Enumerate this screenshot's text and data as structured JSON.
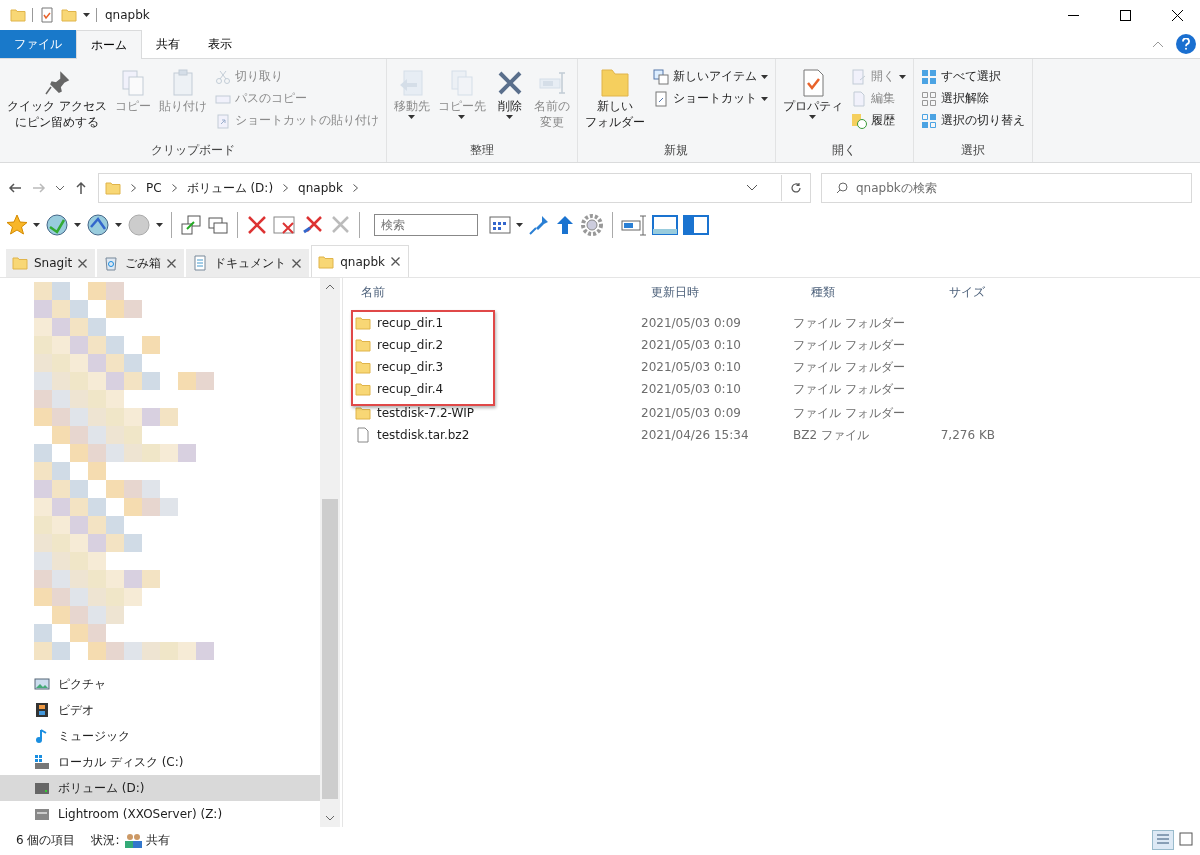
{
  "window": {
    "title": "qnapbk"
  },
  "ribbon_tabs": [
    {
      "label": "ファイル",
      "kind": "file",
      "selected": false
    },
    {
      "label": "ホーム",
      "kind": "tab",
      "selected": true
    },
    {
      "label": "共有",
      "kind": "tab",
      "selected": false
    },
    {
      "label": "表示",
      "kind": "tab",
      "selected": false
    }
  ],
  "ribbon_groups": [
    {
      "label": "クリップボード",
      "items": [
        {
          "kind": "large",
          "label_lines": [
            "クイック アクセス",
            "にピン留めする"
          ],
          "disabled": false,
          "has_menu": false
        },
        {
          "kind": "large",
          "label_lines": [
            "コピー"
          ],
          "disabled": true,
          "has_menu": false
        },
        {
          "kind": "large",
          "label_lines": [
            "貼り付け"
          ],
          "disabled": true,
          "has_menu": false
        },
        {
          "kind": "stack",
          "items": [
            {
              "label": "切り取り",
              "disabled": true,
              "has_menu": false
            },
            {
              "label": "パスのコピー",
              "disabled": true,
              "has_menu": false
            },
            {
              "label": "ショートカットの貼り付け",
              "disabled": true,
              "has_menu": false
            }
          ]
        }
      ]
    },
    {
      "label": "整理",
      "items": [
        {
          "kind": "large",
          "label_lines": [
            "移動先"
          ],
          "disabled": true,
          "has_menu": true
        },
        {
          "kind": "large",
          "label_lines": [
            "コピー先"
          ],
          "disabled": true,
          "has_menu": true
        },
        {
          "kind": "large",
          "label_lines": [
            "削除"
          ],
          "disabled": false,
          "has_menu": true
        },
        {
          "kind": "large",
          "label_lines": [
            "名前の",
            "変更"
          ],
          "disabled": true,
          "has_menu": false
        }
      ]
    },
    {
      "label": "新規",
      "items": [
        {
          "kind": "large",
          "label_lines": [
            "新しい",
            "フォルダー"
          ],
          "disabled": false,
          "has_menu": false
        },
        {
          "kind": "stack",
          "items": [
            {
              "label": "新しいアイテム",
              "disabled": false,
              "has_menu": true
            },
            {
              "label": "ショートカット",
              "disabled": false,
              "has_menu": true
            }
          ]
        }
      ]
    },
    {
      "label": "開く",
      "items": [
        {
          "kind": "large",
          "label_lines": [
            "プロパティ"
          ],
          "disabled": false,
          "has_menu": true
        },
        {
          "kind": "stack",
          "items": [
            {
              "label": "開く",
              "disabled": true,
              "has_menu": true
            },
            {
              "label": "編集",
              "disabled": true,
              "has_menu": false
            },
            {
              "label": "履歴",
              "disabled": false,
              "has_menu": false
            }
          ]
        }
      ]
    },
    {
      "label": "選択",
      "items": [
        {
          "kind": "stack",
          "items": [
            {
              "label": "すべて選択",
              "disabled": false,
              "has_menu": false
            },
            {
              "label": "選択解除",
              "disabled": false,
              "has_menu": false
            },
            {
              "label": "選択の切り替え",
              "disabled": false,
              "has_menu": false
            }
          ]
        }
      ]
    }
  ],
  "address": {
    "segments": [
      "PC",
      "ボリューム (D:)",
      "qnapbk"
    ],
    "search_placeholder": "qnapbkの検索"
  },
  "toolbar": {
    "search_placeholder": "検索"
  },
  "tabs": [
    {
      "label": "Snagit",
      "kind": "folder",
      "selected": false
    },
    {
      "label": "ごみ箱",
      "kind": "recycle",
      "selected": false
    },
    {
      "label": "ドキュメント",
      "kind": "document",
      "selected": false
    },
    {
      "label": "qnapbk",
      "kind": "folder",
      "selected": true
    }
  ],
  "sidebar": {
    "items": [
      {
        "label": "ピクチャ",
        "kind": "pictures",
        "selected": false
      },
      {
        "label": "ビデオ",
        "kind": "videos",
        "selected": false
      },
      {
        "label": "ミュージック",
        "kind": "music",
        "selected": false
      },
      {
        "label": "ローカル ディスク (C:)",
        "kind": "system-drive",
        "selected": false
      },
      {
        "label": "ボリューム (D:)",
        "kind": "drive",
        "selected": true
      },
      {
        "label": "Lightroom (XXOServer) (Z:)",
        "kind": "network-drive",
        "selected": false
      }
    ]
  },
  "table": {
    "columns": [
      "名前",
      "更新日時",
      "種類",
      "サイズ"
    ],
    "rows": [
      {
        "name": "recup_dir.1",
        "date": "2021/05/03 0:09",
        "type": "ファイル フォルダー",
        "kind": "folder",
        "annotated": true
      },
      {
        "name": "recup_dir.2",
        "date": "2021/05/03 0:10",
        "type": "ファイル フォルダー",
        "kind": "folder",
        "annotated": true
      },
      {
        "name": "recup_dir.3",
        "date": "2021/05/03 0:10",
        "type": "ファイル フォルダー",
        "kind": "folder",
        "annotated": true
      },
      {
        "name": "recup_dir.4",
        "date": "2021/05/03 0:10",
        "type": "ファイル フォルダー",
        "kind": "folder",
        "annotated": true
      },
      {
        "name": "testdisk-7.2-WIP",
        "date": "2021/05/03 0:09",
        "type": "ファイル フォルダー",
        "kind": "folder",
        "annotated": false
      },
      {
        "name": "testdisk.tar.bz2",
        "date": "2021/04/26 15:34",
        "type": "BZ2 ファイル",
        "size": "7,276 KB",
        "kind": "file",
        "annotated": false
      }
    ]
  },
  "status_bar": {
    "count": "6 個の項目",
    "state_label": "状況:",
    "state_value": "共有"
  }
}
